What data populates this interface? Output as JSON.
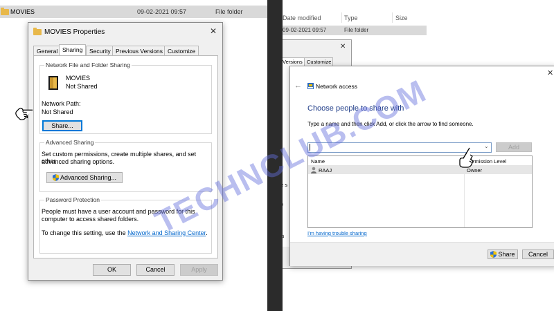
{
  "left": {
    "explorer_row": {
      "name": "MOVIES",
      "date": "09-02-2021 09:57",
      "type": "File folder"
    },
    "properties": {
      "title": "MOVIES Properties",
      "tabs": [
        "General",
        "Sharing",
        "Security",
        "Previous Versions",
        "Customize"
      ],
      "active_tab": "Sharing",
      "network_group": {
        "title": "Network File and Folder Sharing",
        "folder_name": "MOVIES",
        "folder_status": "Not Shared",
        "path_label": "Network Path:",
        "path_value": "Not Shared",
        "share_button": "Share..."
      },
      "advanced_group": {
        "title": "Advanced Sharing",
        "description_1": "Set custom permissions, create multiple shares, and set other",
        "description_2": "advanced sharing options.",
        "button": "Advanced Sharing..."
      },
      "password_group": {
        "title": "Password Protection",
        "line_1": "People must have a user account and password for this",
        "line_2": "computer to access shared folders.",
        "line_3_prefix": "To change this setting, use the ",
        "line_3_link": "Network and Sharing Center",
        "line_3_suffix": "."
      },
      "footer": {
        "ok": "OK",
        "cancel": "Cancel",
        "apply": "Apply"
      }
    }
  },
  "right": {
    "header": {
      "date_modified": "Date modified",
      "type": "Type",
      "size": "Size"
    },
    "row": {
      "date": "09-02-2021 09:57",
      "type": "File folder"
    },
    "bg_tabs": {
      "versions": "Versions",
      "customize": "Customize"
    },
    "bg_fragments": {
      "frag1": "e s",
      "frag2": "e",
      "frag3": "ls"
    },
    "network_access": {
      "title": "Network access",
      "heading": "Choose people to share with",
      "instruction": "Type a name and then click Add, or click the arrow to find someone.",
      "input_value": "",
      "add_button": "Add",
      "columns": {
        "name": "Name",
        "permission": "Permission Level"
      },
      "rows": [
        {
          "name": "RAAJ",
          "permission": "Owner"
        }
      ],
      "trouble_link": "I'm having trouble sharing",
      "share_button": "Share",
      "cancel_button": "Cancel"
    }
  },
  "watermark": "TECHNCLUB.COM"
}
